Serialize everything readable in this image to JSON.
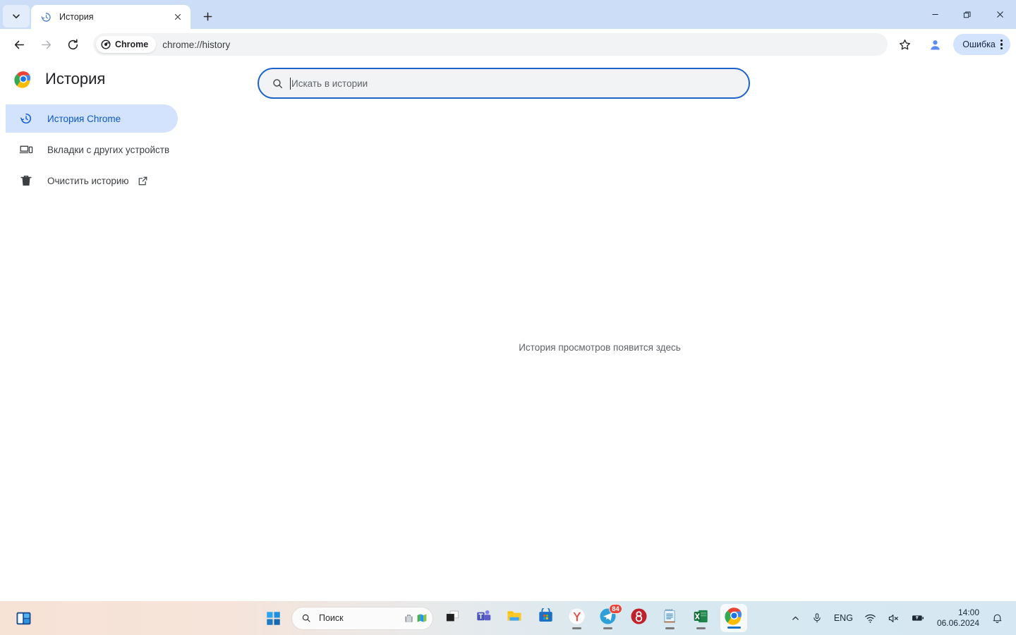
{
  "browser": {
    "tab": {
      "title": "История",
      "favicon": "history-clock-icon"
    },
    "tabsearch_icon": "chevron-down-icon",
    "newtab_label": "+",
    "window_controls": {
      "minimize": "minimize-icon",
      "maximize": "restore-icon",
      "close": "close-icon"
    },
    "toolbar": {
      "back": "back-arrow-icon",
      "forward": "forward-arrow-icon",
      "reload": "reload-icon",
      "chrome_chip": "Chrome",
      "url": "chrome://history",
      "bookmark": "star-icon",
      "profile": "profile-avatar-icon",
      "error_label": "Ошибка",
      "menu": "three-dot-menu-icon"
    }
  },
  "page": {
    "title": "История",
    "logo": "chrome-logo",
    "search": {
      "placeholder": "Искать в истории",
      "value": "",
      "icon": "search-icon"
    },
    "sidebar": {
      "items": [
        {
          "label": "История Chrome",
          "icon": "history-clock-icon",
          "selected": true,
          "external": false
        },
        {
          "label": "Вкладки с других устройств",
          "icon": "devices-icon",
          "selected": false,
          "external": false
        },
        {
          "label": "Очистить историю",
          "icon": "trash-icon",
          "selected": false,
          "external": true,
          "external_icon": "open-in-new-icon"
        }
      ]
    },
    "empty_message": "История просмотров появится здесь"
  },
  "taskbar": {
    "widgets_icon": "widgets-icon",
    "start_icon": "windows-start-icon",
    "search": {
      "placeholder": "Поиск",
      "icon": "search-icon",
      "extra_icons": [
        "suitcase-icon",
        "map-icon"
      ]
    },
    "apps": [
      {
        "name": "task-view",
        "running": false,
        "badge": null
      },
      {
        "name": "microsoft-teams",
        "running": false,
        "badge": null
      },
      {
        "name": "file-explorer",
        "running": false,
        "badge": null
      },
      {
        "name": "microsoft-store",
        "running": false,
        "badge": null
      },
      {
        "name": "yandex-browser",
        "running": true,
        "badge": null
      },
      {
        "name": "telegram",
        "running": true,
        "badge": "84"
      },
      {
        "name": "gitlab",
        "running": false,
        "badge": null
      },
      {
        "name": "notepad",
        "running": true,
        "badge": null
      },
      {
        "name": "microsoft-excel",
        "running": true,
        "badge": null
      },
      {
        "name": "google-chrome",
        "running": true,
        "badge": null,
        "active": true
      }
    ],
    "tray": {
      "overflow_icon": "chevron-up-icon",
      "mic_icon": "microphone-icon",
      "language": "ENG",
      "wifi_icon": "wifi-icon",
      "volume_icon": "volume-muted-icon",
      "battery_icon": "battery-warning-icon",
      "time": "14:00",
      "date": "06.06.2024",
      "notification_icon": "bell-icon"
    }
  },
  "colors": {
    "tabstrip": "#ccddf7",
    "accent_blue": "#0b57d0",
    "sidebar_selected": "#d3e3fd",
    "error_chip": "#d3e3fd"
  }
}
